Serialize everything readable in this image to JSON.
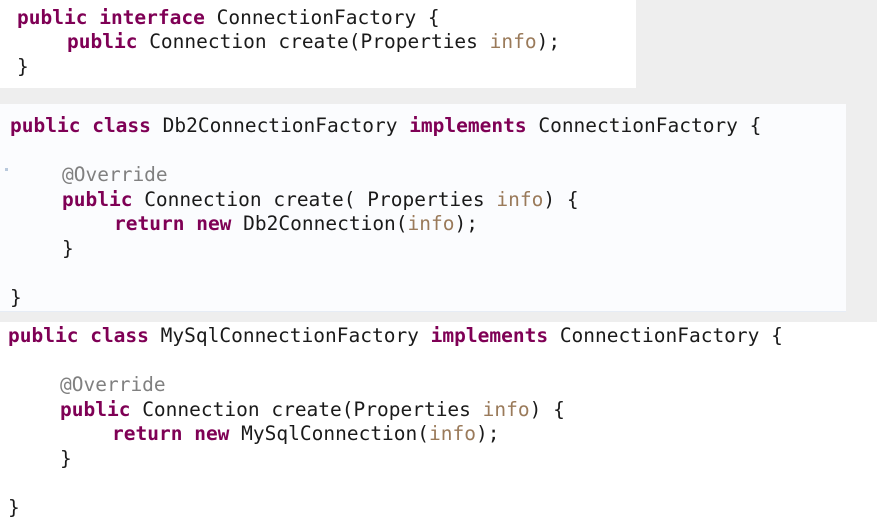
{
  "kw": {
    "public": "public",
    "interface": "interface",
    "class": "class",
    "implements": "implements",
    "return": "return",
    "new": "new"
  },
  "annotation": "@Override",
  "var_info": "info",
  "block1": {
    "iface_name": " ConnectionFactory {",
    "method_sig": " Connection create(Properties ",
    "method_end": ");",
    "close": "}"
  },
  "block2": {
    "class_name": " Db2ConnectionFactory ",
    "iface_name": " ConnectionFactory {",
    "method_sig": " Connection create( Properties ",
    "method_end": ") {",
    "return_call": " Db2Connection(",
    "return_end": ");",
    "inner_close": "}",
    "close": "}"
  },
  "block3": {
    "class_name": " MySqlConnectionFactory ",
    "iface_name": " ConnectionFactory {",
    "method_sig": " Connection create(Properties ",
    "method_end": ") {",
    "return_call": " MySqlConnection(",
    "return_end": ");",
    "inner_close": "}",
    "close": "}"
  }
}
